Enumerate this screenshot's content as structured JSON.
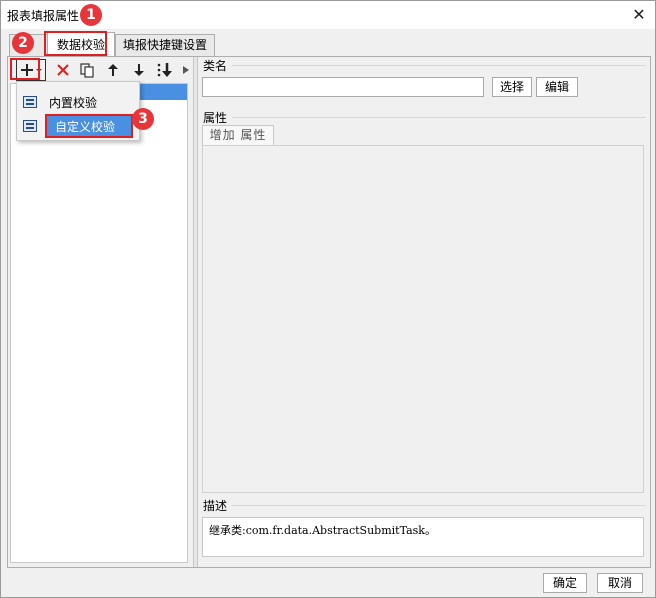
{
  "window": {
    "title": "报表填报属性"
  },
  "tabs": [
    {
      "label": ""
    },
    {
      "label": "数据校验",
      "active": true
    },
    {
      "label": "填报快捷键设置"
    }
  ],
  "toolbar": {
    "add_icon": "plus-dropdown-icon",
    "delete_icon": "red-x-icon",
    "copy_icon": "copy-icon",
    "up_icon": "arrow-up-icon",
    "down_icon": "arrow-down-icon",
    "sort_icon": "sort-down-icon"
  },
  "dropdown": {
    "items": [
      {
        "label": "内置校验"
      },
      {
        "label": "自定义校验",
        "selected": true
      }
    ]
  },
  "right": {
    "class_label": "类名",
    "class_value": "",
    "choose_label": "选择",
    "edit_label": "编辑",
    "props_label": "属性",
    "add_prop_label": "增加 属性",
    "desc_label": "描述",
    "desc_text": "继承类:com.fr.data.AbstractSubmitTask。"
  },
  "footer": {
    "ok_label": "确定",
    "cancel_label": "取消"
  },
  "callouts": [
    "1",
    "2",
    "3"
  ],
  "colors": {
    "highlight": "#e02020",
    "callout": "#e8353a",
    "selection": "#4a90e2"
  }
}
